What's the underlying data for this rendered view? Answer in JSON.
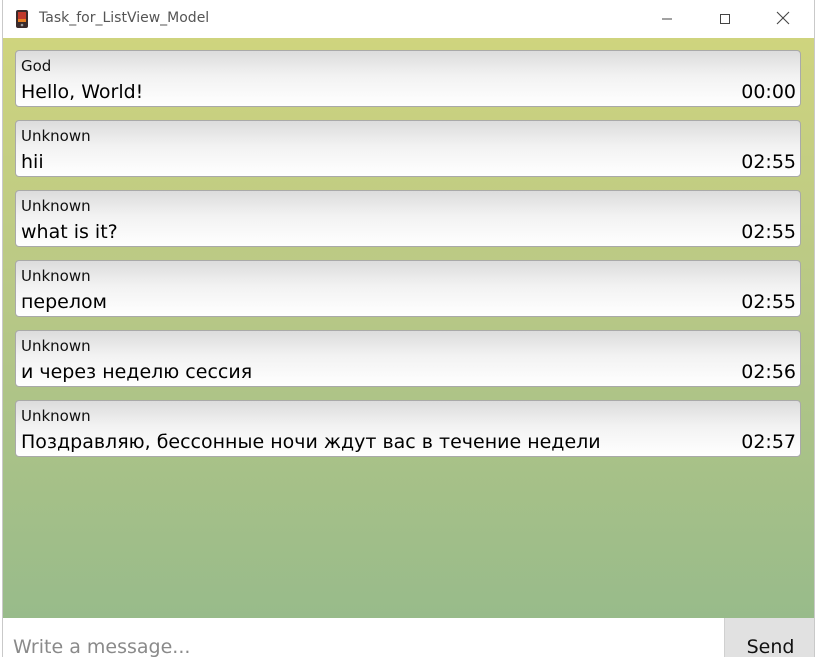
{
  "window": {
    "title": "Task_for_ListView_Model"
  },
  "messages": [
    {
      "author": "God",
      "text": "Hello, World!",
      "time": "00:00"
    },
    {
      "author": "Unknown",
      "text": "hii",
      "time": "02:55"
    },
    {
      "author": "Unknown",
      "text": "what is it?",
      "time": "02:55"
    },
    {
      "author": "Unknown",
      "text": "перелом",
      "time": "02:55"
    },
    {
      "author": "Unknown",
      "text": "и через неделю сессия",
      "time": "02:56"
    },
    {
      "author": "Unknown",
      "text": "Поздравляю, бессонные ночи ждут вас в течение недели",
      "time": "02:57"
    }
  ],
  "composer": {
    "placeholder": "Write a message...",
    "send_label": "Send"
  },
  "colors": {
    "background_top": "#cfd47e",
    "background_bottom": "#98bb8a",
    "bubble_border": "#a9a9a9",
    "send_button": "#e1e1e1"
  },
  "icons": {
    "app": "app-icon",
    "minimize": "minimize-icon",
    "maximize": "maximize-icon",
    "close": "close-icon"
  }
}
